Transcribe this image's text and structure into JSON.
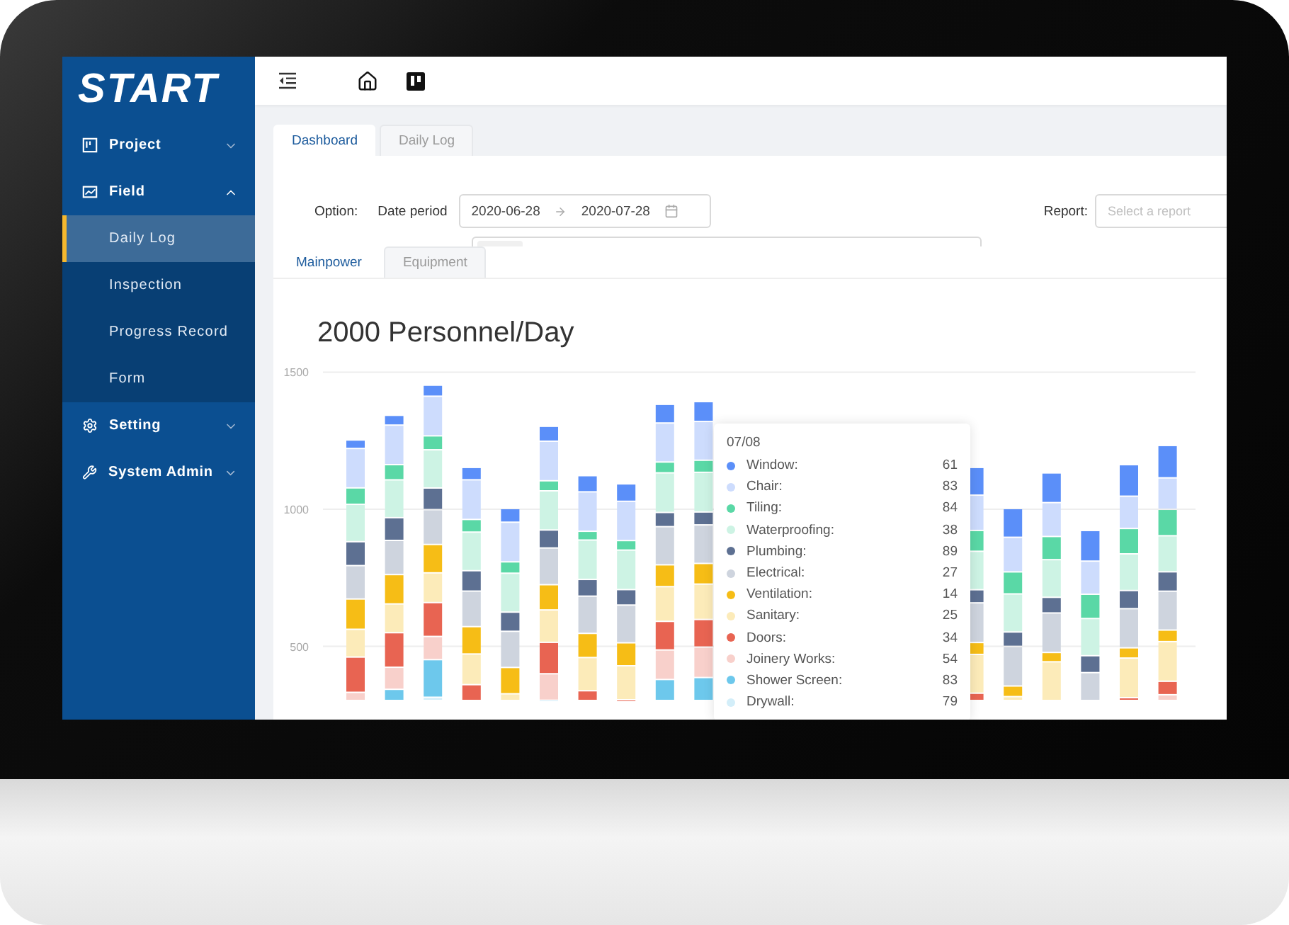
{
  "logo": "START",
  "sidebar": {
    "items": [
      {
        "label": "Project",
        "expanded": false
      },
      {
        "label": "Field",
        "expanded": true,
        "children": [
          {
            "label": "Daily Log",
            "selected": true
          },
          {
            "label": "Inspection",
            "selected": false
          },
          {
            "label": "Progress Record",
            "selected": false
          },
          {
            "label": "Form",
            "selected": false
          }
        ]
      },
      {
        "label": "Setting",
        "expanded": false
      },
      {
        "label": "System Admin",
        "expanded": false
      }
    ]
  },
  "tabs": [
    {
      "label": "Dashboard",
      "selected": true
    },
    {
      "label": "Daily Log",
      "selected": false
    }
  ],
  "filters": {
    "option_label": "Option:",
    "date_label": "Date period",
    "date_start": "2020-06-28",
    "date_end": "2020-07-28",
    "report_label": "Report:",
    "report_placeholder": "Select a report"
  },
  "sub_tabs": [
    {
      "label": "Mainpower",
      "selected": true
    },
    {
      "label": "Equipment",
      "selected": false
    }
  ],
  "chart": {
    "title": "2000 Personnel/Day",
    "y_ticks": [
      "1500",
      "1000",
      "500"
    ]
  },
  "tooltip": {
    "title": "07/08",
    "rows": [
      {
        "label": "Window:",
        "value": "61",
        "color": "#5b8ff9"
      },
      {
        "label": "Chair:",
        "value": "83",
        "color": "#cddcfd"
      },
      {
        "label": "Tiling:",
        "value": "84",
        "color": "#5ad8a6"
      },
      {
        "label": "Waterproofing:",
        "value": "38",
        "color": "#cdf3e4"
      },
      {
        "label": "Plumbing:",
        "value": "89",
        "color": "#5d7092"
      },
      {
        "label": "Electrical:",
        "value": "27",
        "color": "#ced4de"
      },
      {
        "label": "Ventilation:",
        "value": "14",
        "color": "#f6bd16"
      },
      {
        "label": "Sanitary:",
        "value": "25",
        "color": "#fcebb9"
      },
      {
        "label": "Doors:",
        "value": "34",
        "color": "#e86452"
      },
      {
        "label": "Joinery Works:",
        "value": "54",
        "color": "#f8d0cb"
      },
      {
        "label": "Shower Screen:",
        "value": "83",
        "color": "#6dc8ec"
      },
      {
        "label": "Drywall:",
        "value": "79",
        "color": "#d3eef9"
      }
    ]
  }
}
